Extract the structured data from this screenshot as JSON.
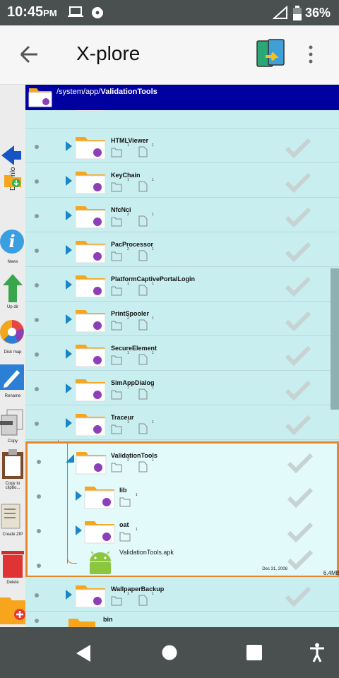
{
  "status_bar": {
    "time": "10:45",
    "ampm": "PM",
    "battery": "36%"
  },
  "toolbar": {
    "title": "X-plore"
  },
  "path": {
    "prefix": "/system/app/",
    "current": "ValidationTools"
  },
  "side_panel": {
    "items": [
      {
        "label": "Downlo",
        "icon": "download-arrow-icon"
      },
      {
        "label": "News",
        "icon": "info-icon"
      },
      {
        "label": "Up dir",
        "icon": "up-arrow-icon"
      },
      {
        "label": "Disk map",
        "icon": "disk-map-icon"
      },
      {
        "label": "Rename",
        "icon": "pencil-icon"
      },
      {
        "label": "Copy",
        "icon": "copy-icon"
      },
      {
        "label": "Copy to clipbo...",
        "icon": "clipboard-icon"
      },
      {
        "label": "Create ZIP",
        "icon": "zip-icon"
      },
      {
        "label": "Delete",
        "icon": "trash-icon"
      }
    ]
  },
  "folders": [
    {
      "name": "",
      "dirs": "",
      "files": ""
    },
    {
      "name": "HTMLViewer",
      "dirs": "1",
      "files": "1"
    },
    {
      "name": "KeyChain",
      "dirs": "1",
      "files": "1"
    },
    {
      "name": "NfcNci",
      "dirs": "2",
      "files": "1"
    },
    {
      "name": "PacProcessor",
      "dirs": "2",
      "files": "1"
    },
    {
      "name": "PlatformCaptivePortalLogin",
      "dirs": "1",
      "files": "1"
    },
    {
      "name": "PrintSpooler",
      "dirs": "2",
      "files": "1"
    },
    {
      "name": "SecureElement",
      "dirs": "1",
      "files": "1"
    },
    {
      "name": "SimAppDialog",
      "dirs": "1",
      "files": "1"
    },
    {
      "name": "Traceur",
      "dirs": "1",
      "files": "1"
    }
  ],
  "selected": {
    "name": "ValidationTools",
    "dirs": "2",
    "files": "1",
    "children": [
      {
        "name": "lib",
        "dirs": "1"
      },
      {
        "name": "oat",
        "dirs": "1"
      }
    ],
    "apk": {
      "name": "ValidationTools.apk",
      "date": "Dec 31, 2008",
      "size": "6.4MB"
    }
  },
  "after": [
    {
      "name": "WallpaperBackup",
      "dirs": "1",
      "files": "1"
    },
    {
      "name": "bin"
    }
  ]
}
